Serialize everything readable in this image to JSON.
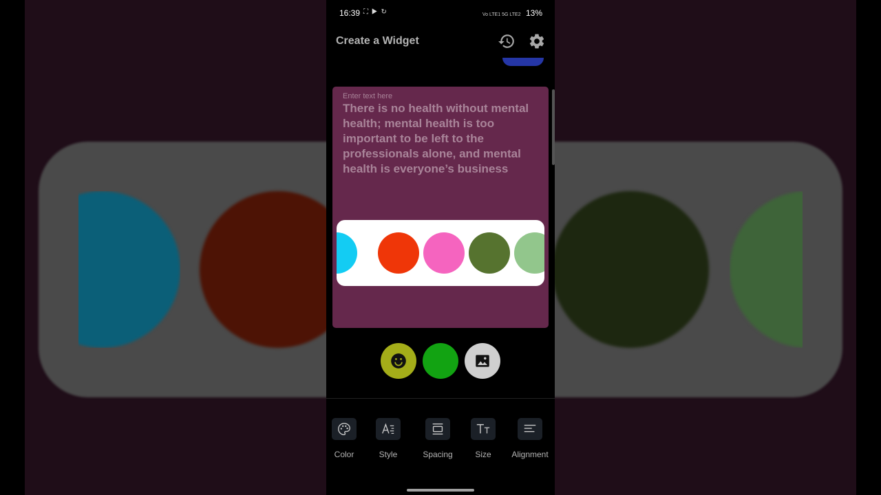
{
  "status_bar": {
    "time": "16:39",
    "net_label": "Vo LTE1 5G LTE2",
    "battery": "13%"
  },
  "header": {
    "title": "Create a Widget"
  },
  "preview": {
    "background_color": "#65284c",
    "placeholder": "Enter text here",
    "text": "There is no health without mental health; mental health is too important to be left to the professionals alone, and mental health is everyone’s business"
  },
  "color_palette": {
    "swatches": [
      "#13ccf3",
      "#ef3608",
      "#f564bf",
      "#56732f",
      "#92c68c"
    ]
  },
  "actions": {
    "emoji_color": "#a4ad19",
    "color_color": "#12a312",
    "image_color": "#cfcfcf"
  },
  "toolbar": {
    "items": [
      {
        "label": "Color",
        "icon": "palette-icon"
      },
      {
        "label": "Style",
        "icon": "text-style-icon"
      },
      {
        "label": "Spacing",
        "icon": "spacing-icon"
      },
      {
        "label": "Size",
        "icon": "text-size-icon"
      },
      {
        "label": "Alignment",
        "icon": "align-left-icon"
      }
    ]
  }
}
